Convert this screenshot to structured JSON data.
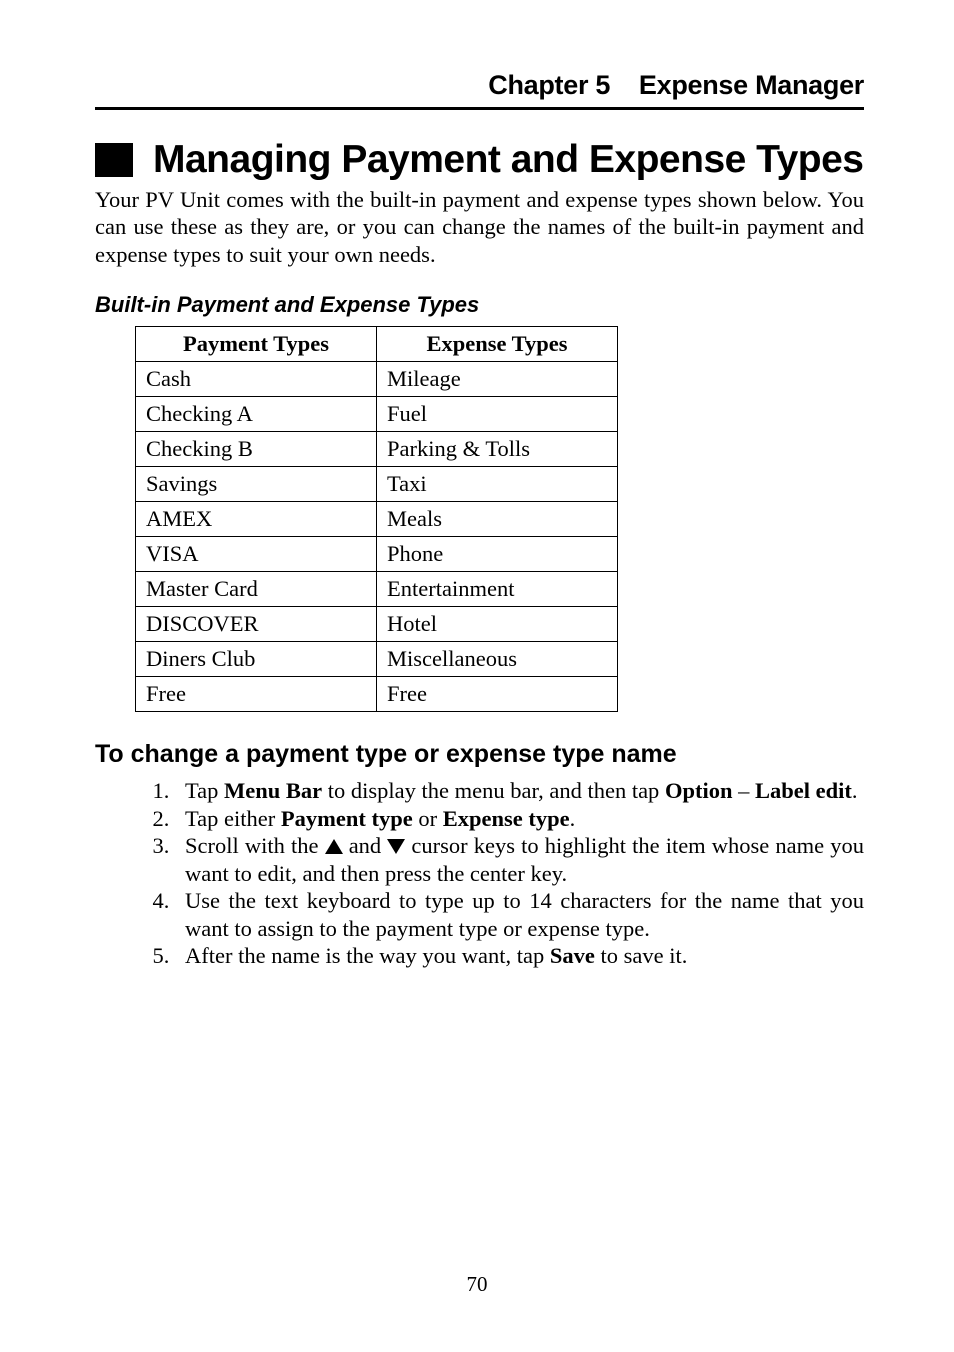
{
  "header": {
    "chapter_label": "Chapter 5",
    "chapter_title": "Expense Manager"
  },
  "section": {
    "title": "Managing Payment and Expense Types",
    "intro": "Your PV Unit comes with the built-in payment and expense types shown below. You can use these as they are, or you can change the names of the built-in payment and expense types to suit your own needs."
  },
  "table_section": {
    "heading": "Built-in Payment and Expense Types",
    "columns": {
      "payment": "Payment Types",
      "expense": "Expense Types"
    },
    "rows": [
      {
        "payment": "Cash",
        "expense": "Mileage"
      },
      {
        "payment": "Checking A",
        "expense": "Fuel"
      },
      {
        "payment": "Checking B",
        "expense": "Parking & Tolls"
      },
      {
        "payment": "Savings",
        "expense": "Taxi"
      },
      {
        "payment": "AMEX",
        "expense": "Meals"
      },
      {
        "payment": "VISA",
        "expense": "Phone"
      },
      {
        "payment": "Master Card",
        "expense": "Entertainment"
      },
      {
        "payment": "DISCOVER",
        "expense": "Hotel"
      },
      {
        "payment": "Diners Club",
        "expense": "Miscellaneous"
      },
      {
        "payment": "Free",
        "expense": "Free"
      }
    ]
  },
  "howto": {
    "heading": "To change a payment type or expense type name",
    "steps": {
      "s1a": "Tap ",
      "s1b": "Menu Bar",
      "s1c": " to display the menu bar, and then tap ",
      "s1d": "Option",
      "s1e": " – ",
      "s1f": "Label edit",
      "s1g": ".",
      "s2a": "Tap either ",
      "s2b": "Payment type",
      "s2c": " or ",
      "s2d": "Expense type",
      "s2e": ".",
      "s3a": "Scroll with the ",
      "s3b": " and ",
      "s3c": " cursor keys to highlight the item whose name you want to edit, and then press the center key.",
      "s4": "Use the text keyboard to type up to 14 characters for the name that you want to assign to the payment type or expense type.",
      "s5a": "After the name is the way you want, tap ",
      "s5b": "Save",
      "s5c": " to save it."
    }
  },
  "page_number": "70"
}
